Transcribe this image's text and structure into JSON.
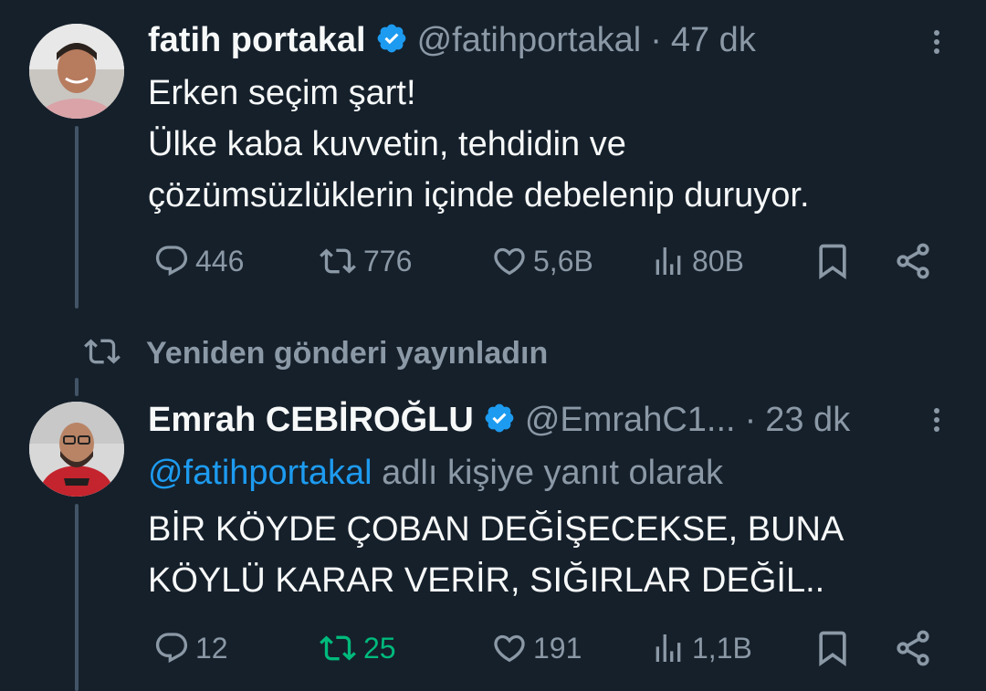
{
  "tweets": [
    {
      "author_name": "fatih portakal",
      "handle": "@fatihportakal",
      "separator": "·",
      "time": "47 dk",
      "lines": [
        "Erken seçim şart!",
        "Ülke kaba kuvvetin, tehdidin ve",
        "çözümsüzlüklerin içinde debelenip duruyor."
      ],
      "actions": {
        "replies": "446",
        "reposts": "776",
        "likes": "5,6B",
        "views": "80B"
      }
    },
    {
      "repost_label": "Yeniden gönderi yayınladın",
      "author_name": "Emrah CEBİROĞLU",
      "handle": "@EmrahC1...",
      "separator": "·",
      "time": "23 dk",
      "reply_to_handle": "@fatihportakal",
      "reply_to_suffix": " adlı kişiye yanıt olarak",
      "lines": [
        "BİR KÖYDE ÇOBAN DEĞİŞECEKSE, BUNA",
        "KÖYLÜ KARAR VERİR, SIĞIRLAR DEĞİL.."
      ],
      "actions": {
        "replies": "12",
        "reposts": "25",
        "likes": "191",
        "views": "1,1B"
      }
    }
  ],
  "colors": {
    "background": "#15202b",
    "text": "#f7f9f9",
    "muted": "#8b98a5",
    "link": "#1d9bf0",
    "verified": "#1d9bf0",
    "repost_active": "#00ba7c"
  }
}
